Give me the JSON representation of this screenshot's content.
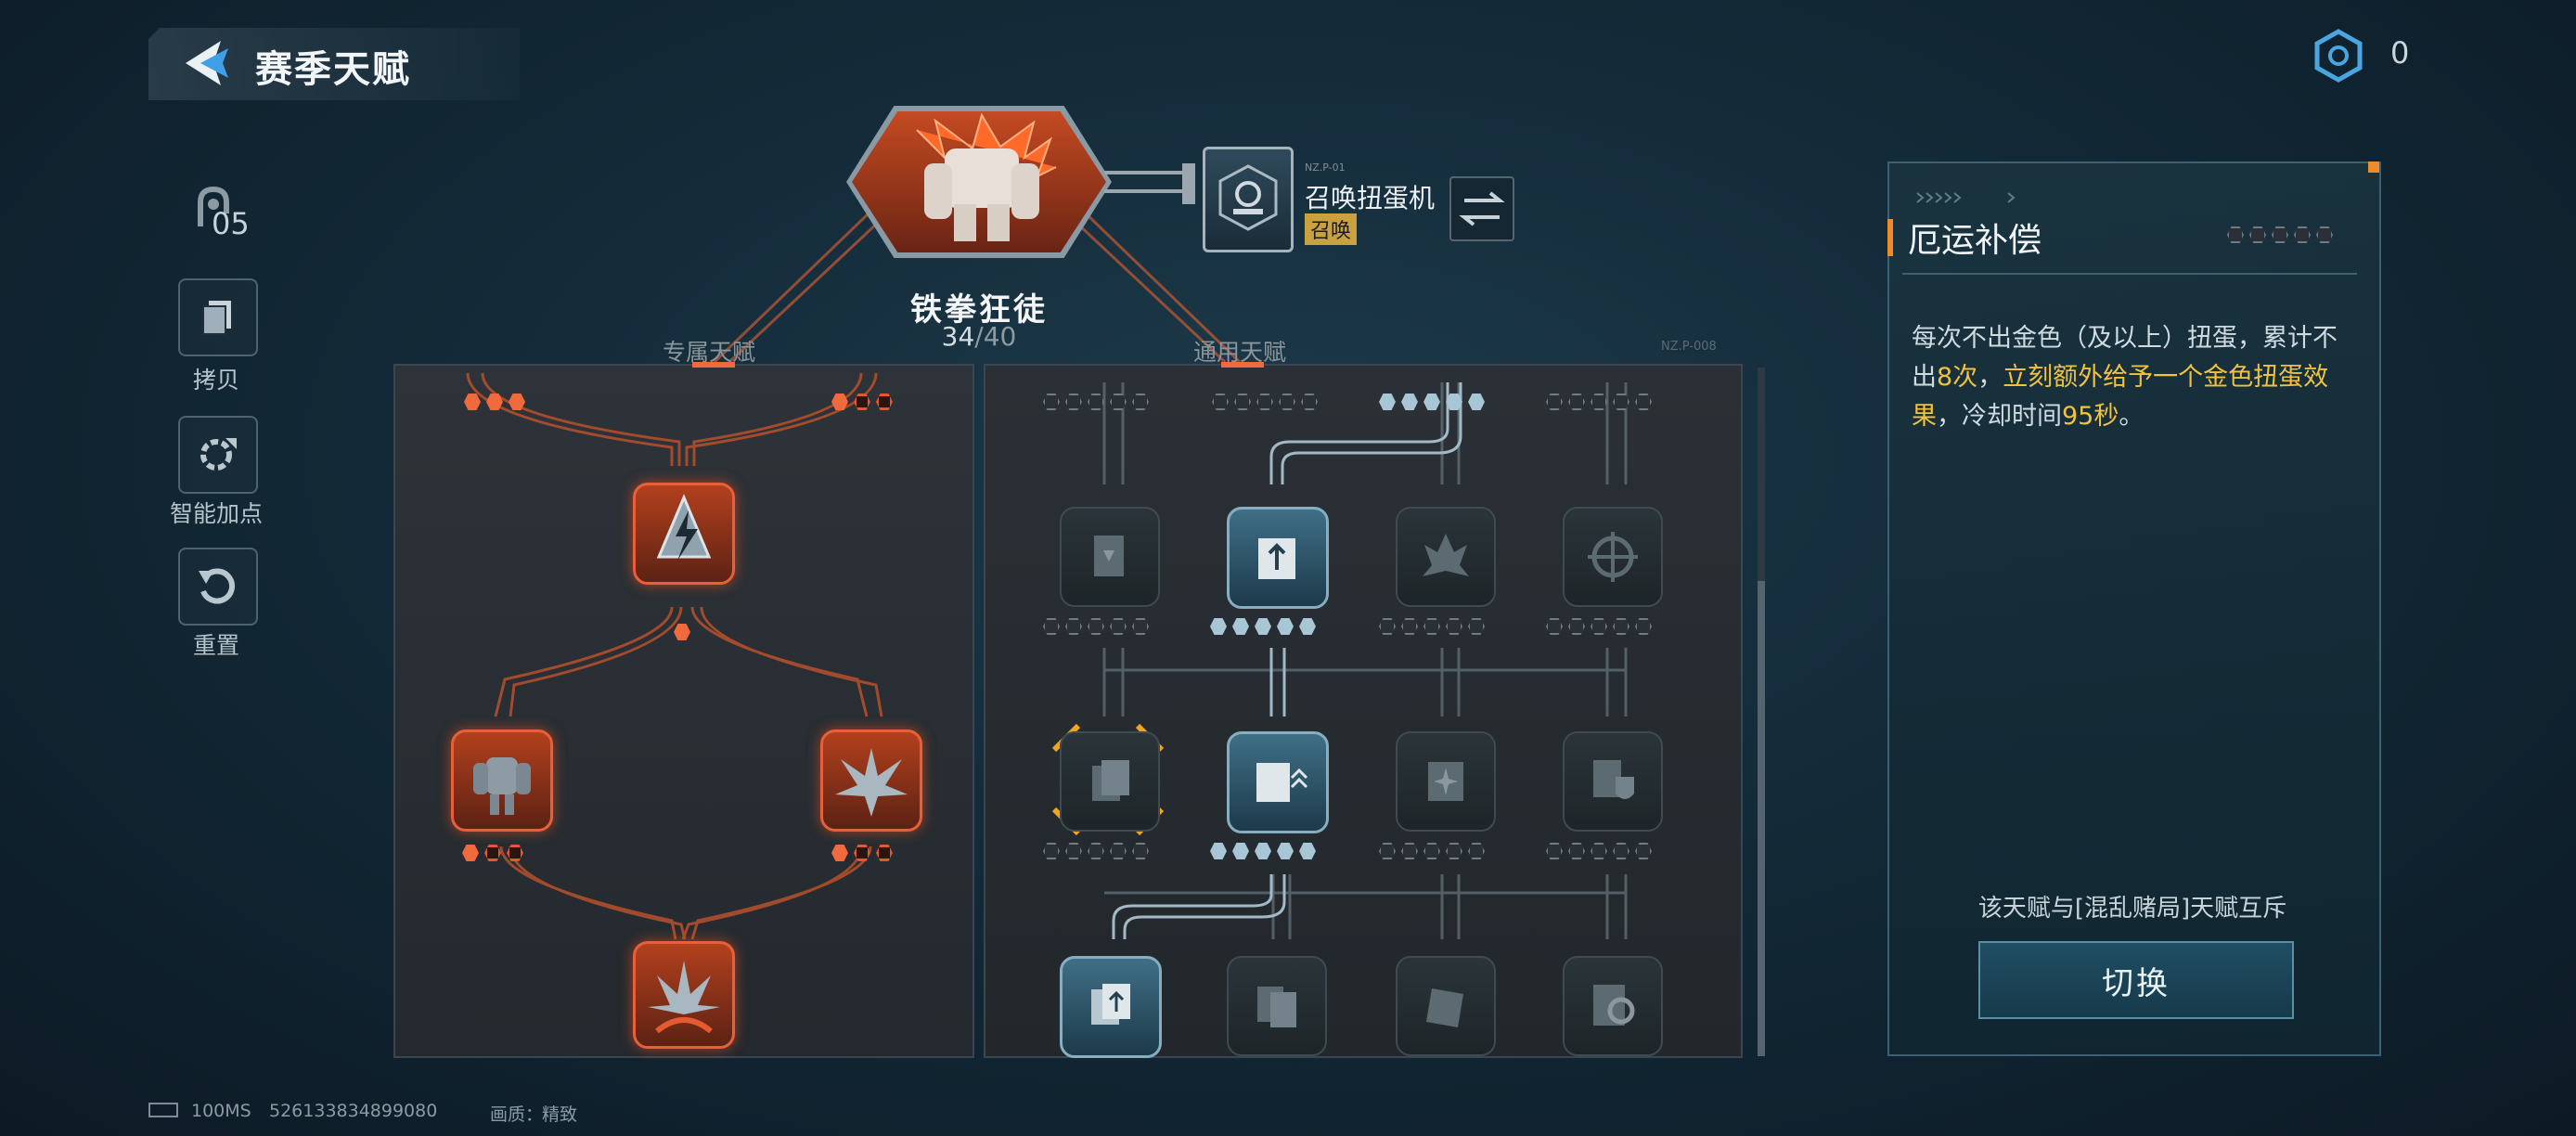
{
  "header": {
    "title": "赛季天赋",
    "currency_value": "0"
  },
  "sidebar": {
    "points_value": "05",
    "tools": [
      {
        "label": "拷贝",
        "icon": "copy-icon"
      },
      {
        "label": "智能加点",
        "icon": "auto-assign-icon"
      },
      {
        "label": "重置",
        "icon": "reset-icon"
      }
    ]
  },
  "hero": {
    "name": "铁拳狂徒",
    "progress_current": "34",
    "progress_max": "/40",
    "summon_code": "NZ.P-01",
    "summon_name": "召唤扭蛋机",
    "summon_tag": "召唤"
  },
  "panels": {
    "exclusive_label": "专属天赋",
    "general_label": "通用天赋",
    "general_code": "NZ.P-008"
  },
  "exclusive_tree": {
    "top_left_dots": {
      "filled": 3,
      "total": 3
    },
    "top_right_dots": {
      "filled": 1,
      "total": 3
    },
    "center_dot": {
      "filled": 1,
      "total": 1
    },
    "left_node_dots": {
      "filled": 1,
      "total": 3
    },
    "right_node_dots": {
      "filled": 1,
      "total": 3
    }
  },
  "general_tree": {
    "top_row_dots": [
      {
        "filled": 0,
        "total": 5
      },
      {
        "filled": 0,
        "total": 5
      },
      {
        "filled": 5,
        "total": 5
      },
      {
        "filled": 0,
        "total": 5
      }
    ],
    "row1_dots": [
      {
        "filled": 0,
        "total": 5
      },
      {
        "filled": 5,
        "total": 5
      },
      {
        "filled": 0,
        "total": 5
      },
      {
        "filled": 0,
        "total": 5
      }
    ],
    "row2_dots": [
      {
        "filled": 0,
        "total": 5
      },
      {
        "filled": 5,
        "total": 5
      },
      {
        "filled": 0,
        "total": 5
      },
      {
        "filled": 0,
        "total": 5
      }
    ]
  },
  "detail": {
    "title": "厄运补偿",
    "rank_filled": 0,
    "rank_total": 5,
    "desc_part1": "每次不出金色（及以上）扭蛋，累计不出",
    "desc_hl1": "8次",
    "desc_part2": "，",
    "desc_hl2": "立刻额外给予一个金色扭蛋效果",
    "desc_part3": "，冷却时间",
    "desc_hl3": "95秒",
    "desc_part4": "。",
    "exclusive_note": "该天赋与[混乱赌局]天赋互斥",
    "switch_label": "切换"
  },
  "footer": {
    "ping": "100MS",
    "id": "526133834899080",
    "quality_label": "画质：",
    "quality_value": "精致"
  },
  "colors": {
    "accent_orange": "#f16a3e",
    "accent_gold": "#f1c23d",
    "active_blue": "#86aec0"
  }
}
